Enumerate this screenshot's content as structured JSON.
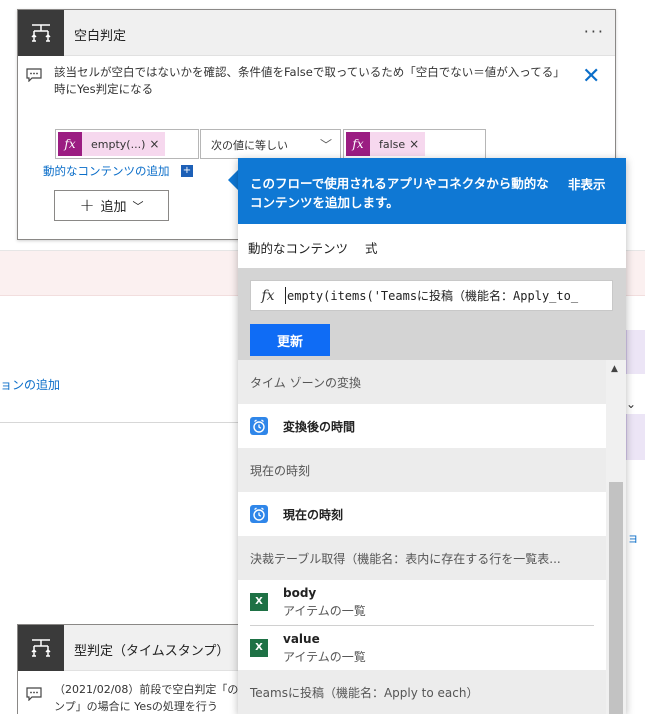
{
  "background": {
    "link_left": "ョンの追加",
    "link_right": "ョ"
  },
  "condition_card": {
    "title": "空白判定",
    "more": "···",
    "note": "該当セルが空白ではないかを確認、条件値をFalseで取っているため「空白でない＝値が入ってる」時にYes判定になる",
    "left_token": "empty(...)",
    "operator": "次の値に等しい",
    "right_token": "false",
    "token_remove": "×",
    "fx": "fx",
    "dynamic_content_link": "動的なコンテンツの追加",
    "dynamic_content_plus": "+",
    "add_button": "追加"
  },
  "second_card": {
    "title": "型判定（タイムスタンプ）",
    "note_line1": "（2021/02/08）前段で空白判定「の",
    "note_line2": "ンプ」の場合に Yesの処理を行う"
  },
  "popup": {
    "header": "このフローで使用されるアプリやコネクタから動的なコンテンツを追加します。",
    "hide": "非表示",
    "tabs": [
      "動的なコンテンツ",
      "式"
    ],
    "expression": "empty(items('Teamsに投稿（機能名：Apply_to_",
    "update_button": "更新",
    "groups": [
      {
        "header": "タイム ゾーンの変換",
        "items": [
          {
            "label": "変換後の時間"
          }
        ]
      },
      {
        "header": "現在の時刻",
        "items": [
          {
            "label": "現在の時刻"
          }
        ]
      },
      {
        "header": "決裁テーブル取得（機能名：表内に存在する行を一覧表...",
        "items": [
          {
            "title": "body",
            "subtitle": "アイテムの一覧"
          },
          {
            "title": "value",
            "subtitle": "アイテムの一覧"
          }
        ]
      },
      {
        "header": "Teamsに投稿（機能名：Apply to each）",
        "items": []
      }
    ]
  },
  "colors": {
    "accent_blue": "#0f78d4",
    "fx_purple": "#9b1d82",
    "token_pink": "#f6d8ee",
    "update_blue": "#0f6cf5",
    "excel_green": "#1e7145"
  }
}
